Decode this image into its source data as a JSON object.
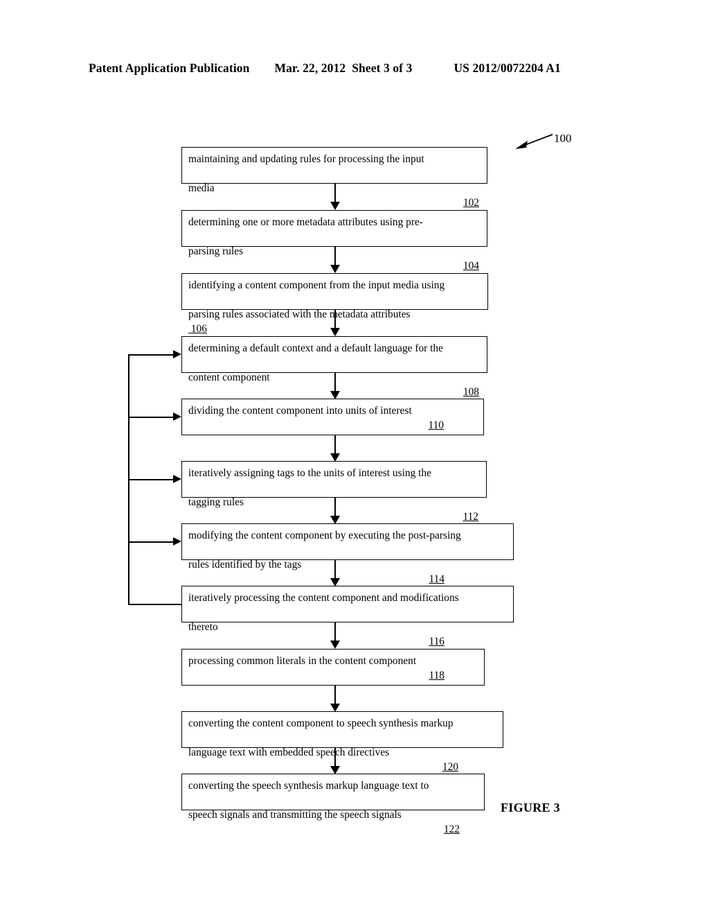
{
  "header": {
    "publication": "Patent Application Publication",
    "date": "Mar. 22, 2012",
    "sheet": "Sheet 3 of 3",
    "patent_number": "US 2012/0072204 A1"
  },
  "figure": {
    "caption": "FIGURE 3",
    "reference_numeral": "100"
  },
  "flowchart": {
    "type": "flowchart",
    "orientation": "vertical",
    "steps": [
      {
        "id": "102",
        "number": "102",
        "text": "maintaining and updating rules for processing the input media",
        "line1": "maintaining and updating rules for processing the input",
        "line2": "media"
      },
      {
        "id": "104",
        "number": "104",
        "text": "determining one or more metadata attributes using pre-parsing rules",
        "line1": "determining one or more metadata attributes using pre-",
        "line2": "parsing rules"
      },
      {
        "id": "106",
        "number": "106",
        "text": "identifying a content component from the input media using parsing rules associated with the metadata attributes",
        "line1": "identifying a content component from the input media using",
        "line2": "parsing rules associated with the metadata attributes"
      },
      {
        "id": "108",
        "number": "108",
        "text": "determining a default context and a default language for the content component",
        "line1": "determining a default context and a default language for the",
        "line2": "content component"
      },
      {
        "id": "110",
        "number": "110",
        "text": "dividing the content component into units of interest",
        "line1": "dividing the content component into units of interest",
        "line2": ""
      },
      {
        "id": "112",
        "number": "112",
        "text": "iteratively assigning tags to the units of interest using the tagging rules",
        "line1": "iteratively assigning tags to the units of interest using the",
        "line2": "tagging rules"
      },
      {
        "id": "114",
        "number": "114",
        "text": "modifying the content component by executing the post-parsing rules identified by the tags",
        "line1": "modifying the content component by executing the post-parsing",
        "line2": "rules identified by the tags"
      },
      {
        "id": "116",
        "number": "116",
        "text": "iteratively processing the content component and modifications thereto",
        "line1": "iteratively processing the content component and modifications",
        "line2": "thereto"
      },
      {
        "id": "118",
        "number": "118",
        "text": "processing common literals in the content component",
        "line1": "processing common literals in the content component",
        "line2": ""
      },
      {
        "id": "120",
        "number": "120",
        "text": "converting the content component to speech synthesis markup language text with embedded speech directives",
        "line1": "converting the content component to speech synthesis markup",
        "line2": "language text with embedded speech directives"
      },
      {
        "id": "122",
        "number": "122",
        "text": "converting the speech synthesis markup language text to speech signals and transmitting the speech signals",
        "line1": "converting the speech synthesis markup language text to",
        "line2": "speech signals and transmitting the speech signals"
      }
    ],
    "feedback_targets": [
      "108",
      "110",
      "112",
      "114"
    ],
    "feedback_source": "116"
  }
}
